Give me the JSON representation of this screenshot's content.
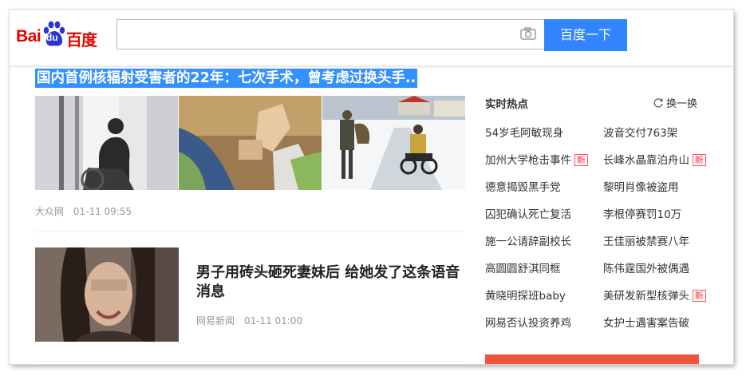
{
  "header": {
    "logo_bai": "Bai",
    "logo_du": "du",
    "logo_cn": "百度",
    "search_value": "",
    "search_button": "百度一下"
  },
  "article": {
    "headline": "国内首例核辐射受害者的22年：七次手术，曾考虑过换头手..",
    "source": "大众网",
    "time": "01-11 09:55"
  },
  "story": {
    "title": "男子用砖头砸死妻妹后 给她发了这条语音消息",
    "source": "网易新闻",
    "time": "01-11 01:00"
  },
  "hot": {
    "title": "实时热点",
    "refresh_label": "换一换",
    "new_label": "新",
    "left": [
      {
        "text": "54岁毛阿敏现身",
        "is_new": false
      },
      {
        "text": "加州大学枪击事件",
        "is_new": true
      },
      {
        "text": "德意揭毁黑手党",
        "is_new": false
      },
      {
        "text": "囚犯确认死亡复活",
        "is_new": false
      },
      {
        "text": "施一公请辞副校长",
        "is_new": false
      },
      {
        "text": "高圆圆舒淇同框",
        "is_new": false
      },
      {
        "text": "黄晓明探班baby",
        "is_new": false
      },
      {
        "text": "网易否认投资养鸡",
        "is_new": false
      }
    ],
    "right": [
      {
        "text": "波音交付763架",
        "is_new": false
      },
      {
        "text": "长峰水晶靠泊舟山",
        "is_new": true
      },
      {
        "text": "黎明肖像被盗用",
        "is_new": false
      },
      {
        "text": "李根停赛罚10万",
        "is_new": false
      },
      {
        "text": "王佳丽被禁赛八年",
        "is_new": false
      },
      {
        "text": "陈伟霆国外被偶遇",
        "is_new": false
      },
      {
        "text": "美研发新型核弹头",
        "is_new": true
      },
      {
        "text": "女护士遇害案告破",
        "is_new": false
      }
    ]
  },
  "colors": {
    "brand_red": "#e10601",
    "search_blue": "#3385ff",
    "highlight_blue": "#3390ff",
    "banner_orange": "#f0553c"
  },
  "icons": [
    "paw-icon",
    "camera-icon",
    "refresh-icon"
  ]
}
